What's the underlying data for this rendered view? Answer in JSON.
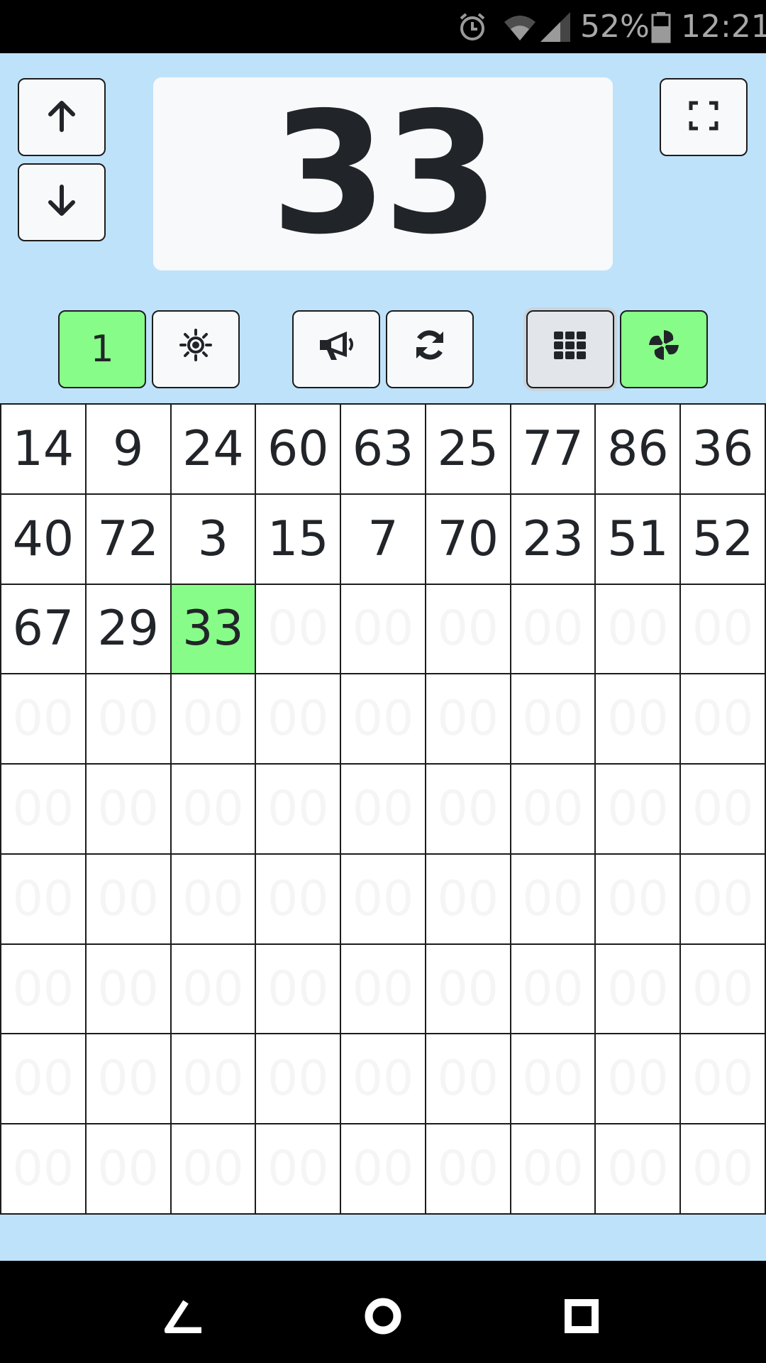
{
  "status_bar": {
    "battery_percent": "52%",
    "time": "12:21",
    "icons": [
      "alarm-icon",
      "wifi-icon",
      "signal-icon",
      "battery-icon"
    ]
  },
  "display": {
    "current_number": "33"
  },
  "controls": {
    "up": "arrow-up-icon",
    "down": "arrow-down-icon",
    "fullscreen": "fullscreen-icon"
  },
  "toolbar": {
    "count_label": "1",
    "buttons": [
      "brightness-icon",
      "megaphone-icon",
      "refresh-icon",
      "grid-icon",
      "pinwheel-icon"
    ]
  },
  "grid": {
    "placeholder": "00",
    "cells": [
      "14",
      "9",
      "24",
      "60",
      "63",
      "25",
      "77",
      "86",
      "36",
      "40",
      "72",
      "3",
      "15",
      "7",
      "70",
      "23",
      "51",
      "52",
      "67",
      "29",
      "33"
    ],
    "current_index": 20,
    "total_cells": 81
  },
  "colors": {
    "background": "#bfe2fb",
    "highlight": "#88fc88",
    "text": "#212529"
  },
  "nav_bar": [
    "back-icon",
    "home-icon",
    "recents-icon"
  ]
}
